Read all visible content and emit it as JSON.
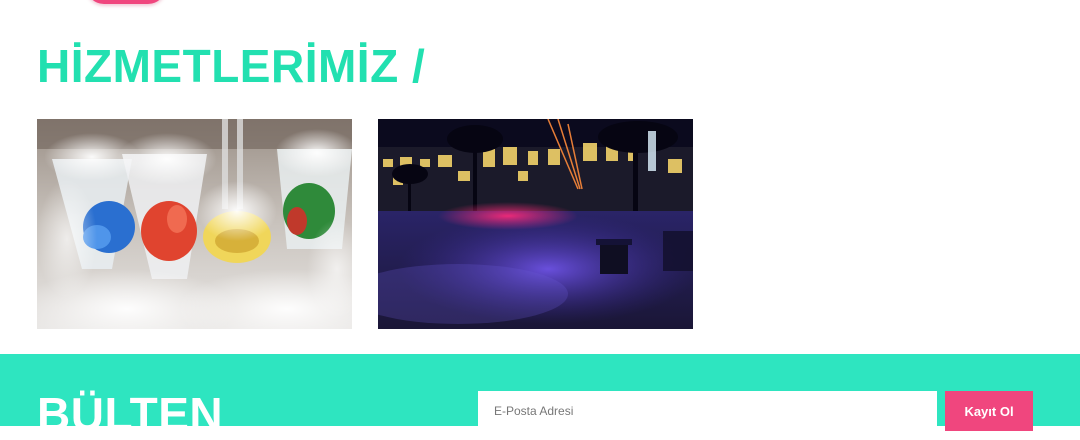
{
  "services": {
    "title": "HİZMETLERİMİZ /",
    "items": [
      {
        "image": "dry-ice-cocktail-glasses-photo"
      },
      {
        "image": "night-fog-event-venue-photo"
      }
    ]
  },
  "newsletter": {
    "title": "BÜLTEN",
    "email_placeholder": "E-Posta Adresi",
    "email_value": "",
    "subscribe_label": "Kayıt Ol"
  },
  "colors": {
    "accent_turquoise": "#22e0b0",
    "newsletter_bg": "#2ee5c0",
    "brand_pink": "#f0467e"
  }
}
